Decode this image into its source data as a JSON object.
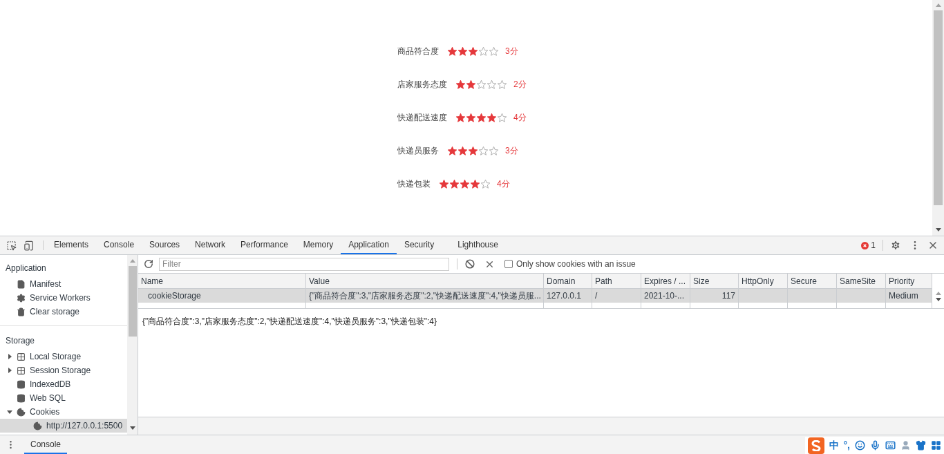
{
  "page": {
    "ratings": [
      {
        "label": "商品符合度",
        "stars": 3,
        "score": "3分"
      },
      {
        "label": "店家服务态度",
        "stars": 2,
        "score": "2分"
      },
      {
        "label": "快递配送速度",
        "stars": 4,
        "score": "4分"
      },
      {
        "label": "快递员服务",
        "stars": 3,
        "score": "3分"
      },
      {
        "label": "快递包装",
        "stars": 4,
        "score": "4分"
      }
    ]
  },
  "devtools": {
    "tabs": [
      {
        "label": "Elements",
        "selected": false
      },
      {
        "label": "Console",
        "selected": false
      },
      {
        "label": "Sources",
        "selected": false
      },
      {
        "label": "Network",
        "selected": false
      },
      {
        "label": "Performance",
        "selected": false
      },
      {
        "label": "Memory",
        "selected": false
      },
      {
        "label": "Application",
        "selected": true
      },
      {
        "label": "Security",
        "selected": false
      },
      {
        "label": "Lighthouse",
        "selected": false
      }
    ],
    "error_count": "1",
    "sidebar": {
      "sections": [
        {
          "title": "Application",
          "items": [
            {
              "label": "Manifest",
              "kind": "file",
              "selected": false
            },
            {
              "label": "Service Workers",
              "kind": "gear",
              "selected": false
            },
            {
              "label": "Clear storage",
              "kind": "trash",
              "selected": false
            }
          ]
        },
        {
          "title": "Storage",
          "items": [
            {
              "label": "Local Storage",
              "kind": "grid",
              "expanded": false,
              "selected": false
            },
            {
              "label": "Session Storage",
              "kind": "grid",
              "expanded": false,
              "selected": false
            },
            {
              "label": "IndexedDB",
              "kind": "database",
              "selected": false
            },
            {
              "label": "Web SQL",
              "kind": "database",
              "selected": false
            },
            {
              "label": "Cookies",
              "kind": "cookie",
              "expanded": true,
              "selected": false,
              "children": [
                {
                  "label": "http://127.0.0.1:5500",
                  "kind": "cookie",
                  "selected": true
                }
              ]
            }
          ]
        }
      ]
    },
    "filter": {
      "placeholder": "Filter"
    },
    "issue_checkbox": {
      "label": "Only show cookies with an issue",
      "checked": false
    },
    "table": {
      "columns": [
        "Name",
        "Value",
        "Domain",
        "Path",
        "Expires / ...",
        "Size",
        "HttpOnly",
        "Secure",
        "SameSite",
        "Priority"
      ],
      "rows": [
        {
          "selected": true,
          "cells": [
            "cookieStorage",
            "{\"商品符合度\":3,\"店家服务态度\":2,\"快递配送速度\":4,\"快递员服...",
            "127.0.0.1",
            "/",
            "2021-10-...",
            "117",
            null,
            null,
            null,
            "Medium"
          ]
        }
      ]
    },
    "value_preview": "{\"商品符合度\":3,\"店家服务态度\":2,\"快递配送速度\":4,\"快递员服务\":3,\"快递包装\":4}",
    "drawer": {
      "tabs": [
        {
          "label": "Console",
          "selected": true
        }
      ]
    }
  },
  "ime_bar": {
    "mode": "中",
    "punctuation": "°,"
  }
}
